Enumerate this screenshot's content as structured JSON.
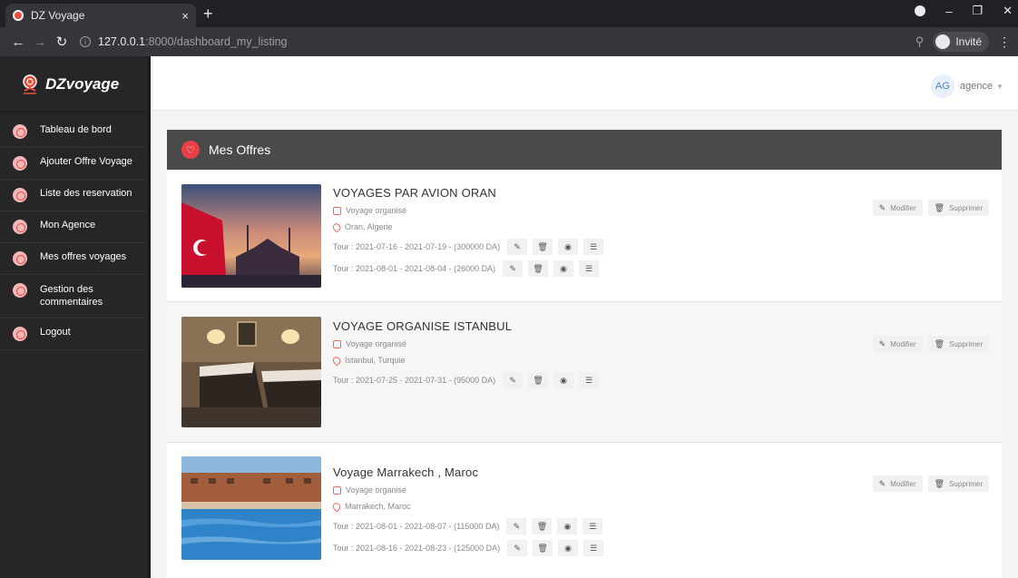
{
  "browser": {
    "tab_title": "DZ Voyage",
    "tab_close": "×",
    "new_tab": "+",
    "url_host": "127.0.0.1",
    "url_rest": ":8000/dashboard_my_listing",
    "profile_label": "Invité",
    "win_min": "–",
    "win_max": "❐",
    "win_close": "✕"
  },
  "sidebar": {
    "brand": "DZvoyage",
    "items": [
      {
        "label": "Tableau de bord"
      },
      {
        "label": "Ajouter Offre Voyage"
      },
      {
        "label": "Liste des reservation"
      },
      {
        "label": "Mon Agence"
      },
      {
        "label": "Mes offres voyages"
      },
      {
        "label": "Gestion des commentaires"
      },
      {
        "label": "Logout"
      }
    ]
  },
  "header": {
    "avatar_initials": "AG",
    "user_name": "agence"
  },
  "panel": {
    "title": "Mes Offres"
  },
  "actions": {
    "edit": "Modifier",
    "delete": "Supprimer"
  },
  "offers": [
    {
      "title": "VOYAGES PAR AVION ORAN",
      "category": "Voyage organisé",
      "location": "Oran, Algerie",
      "tours": [
        "Tour : 2021-07-16 - 2021-07-19 - (300000 DA)",
        "Tour : 2021-08-01 - 2021-08-04 - (26000 DA)"
      ]
    },
    {
      "title": "VOYAGE ORGANISE ISTANBUL",
      "category": "Voyage organisé",
      "location": "Istanbul, Turquie",
      "tours": [
        "Tour : 2021-07-25 - 2021-07-31 - (95000 DA)"
      ]
    },
    {
      "title": "Voyage Marrakech , Maroc",
      "category": "Voyage organisé",
      "location": "Marrakech, Maroc",
      "tours": [
        "Tour : 2021-08-01 - 2021-08-07 - (115000 DA)",
        "Tour : 2021-08-16 - 2021-08-23 - (125000 DA)"
      ]
    }
  ]
}
